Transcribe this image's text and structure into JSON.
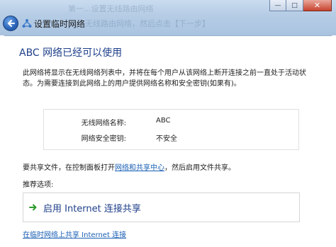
{
  "window": {
    "title": "设置临时网络",
    "controls": {
      "minimize": "—",
      "maximize": "□",
      "close": "✕"
    },
    "background_ghost_text": [
      "第一...设置无线路由网络",
      "无线路由网络，然后点击【下一步】"
    ]
  },
  "content": {
    "heading": "ABC 网络已经可以使用",
    "description": "此网络将显示在无线网络列表中，并将在每个用户从该网络上断开连接之前一直处于活动状态。为需要连接到此网络上的用户提供网络名称和安全密钥(如果有)。",
    "network_info": {
      "name_label": "无线网络名称:",
      "name_value": "ABC",
      "key_label": "网络安全密钥:",
      "key_value": "不安全"
    },
    "share_text_before": "要共享文件，在控制面板打开",
    "share_link": "网络和共享中心",
    "share_text_after": "，然后启用文件共享。",
    "options_label": "推荐选项:",
    "command_link": "启用 Internet 连接共享",
    "bottom_link": "在临时网络上共享 Internet 连接"
  },
  "colors": {
    "heading": "#1e3f8a",
    "link": "#1a5fb4",
    "command_arrow": "#2e9a2e"
  },
  "icons": [
    "back-arrow-icon",
    "network-icon",
    "green-arrow-icon"
  ]
}
